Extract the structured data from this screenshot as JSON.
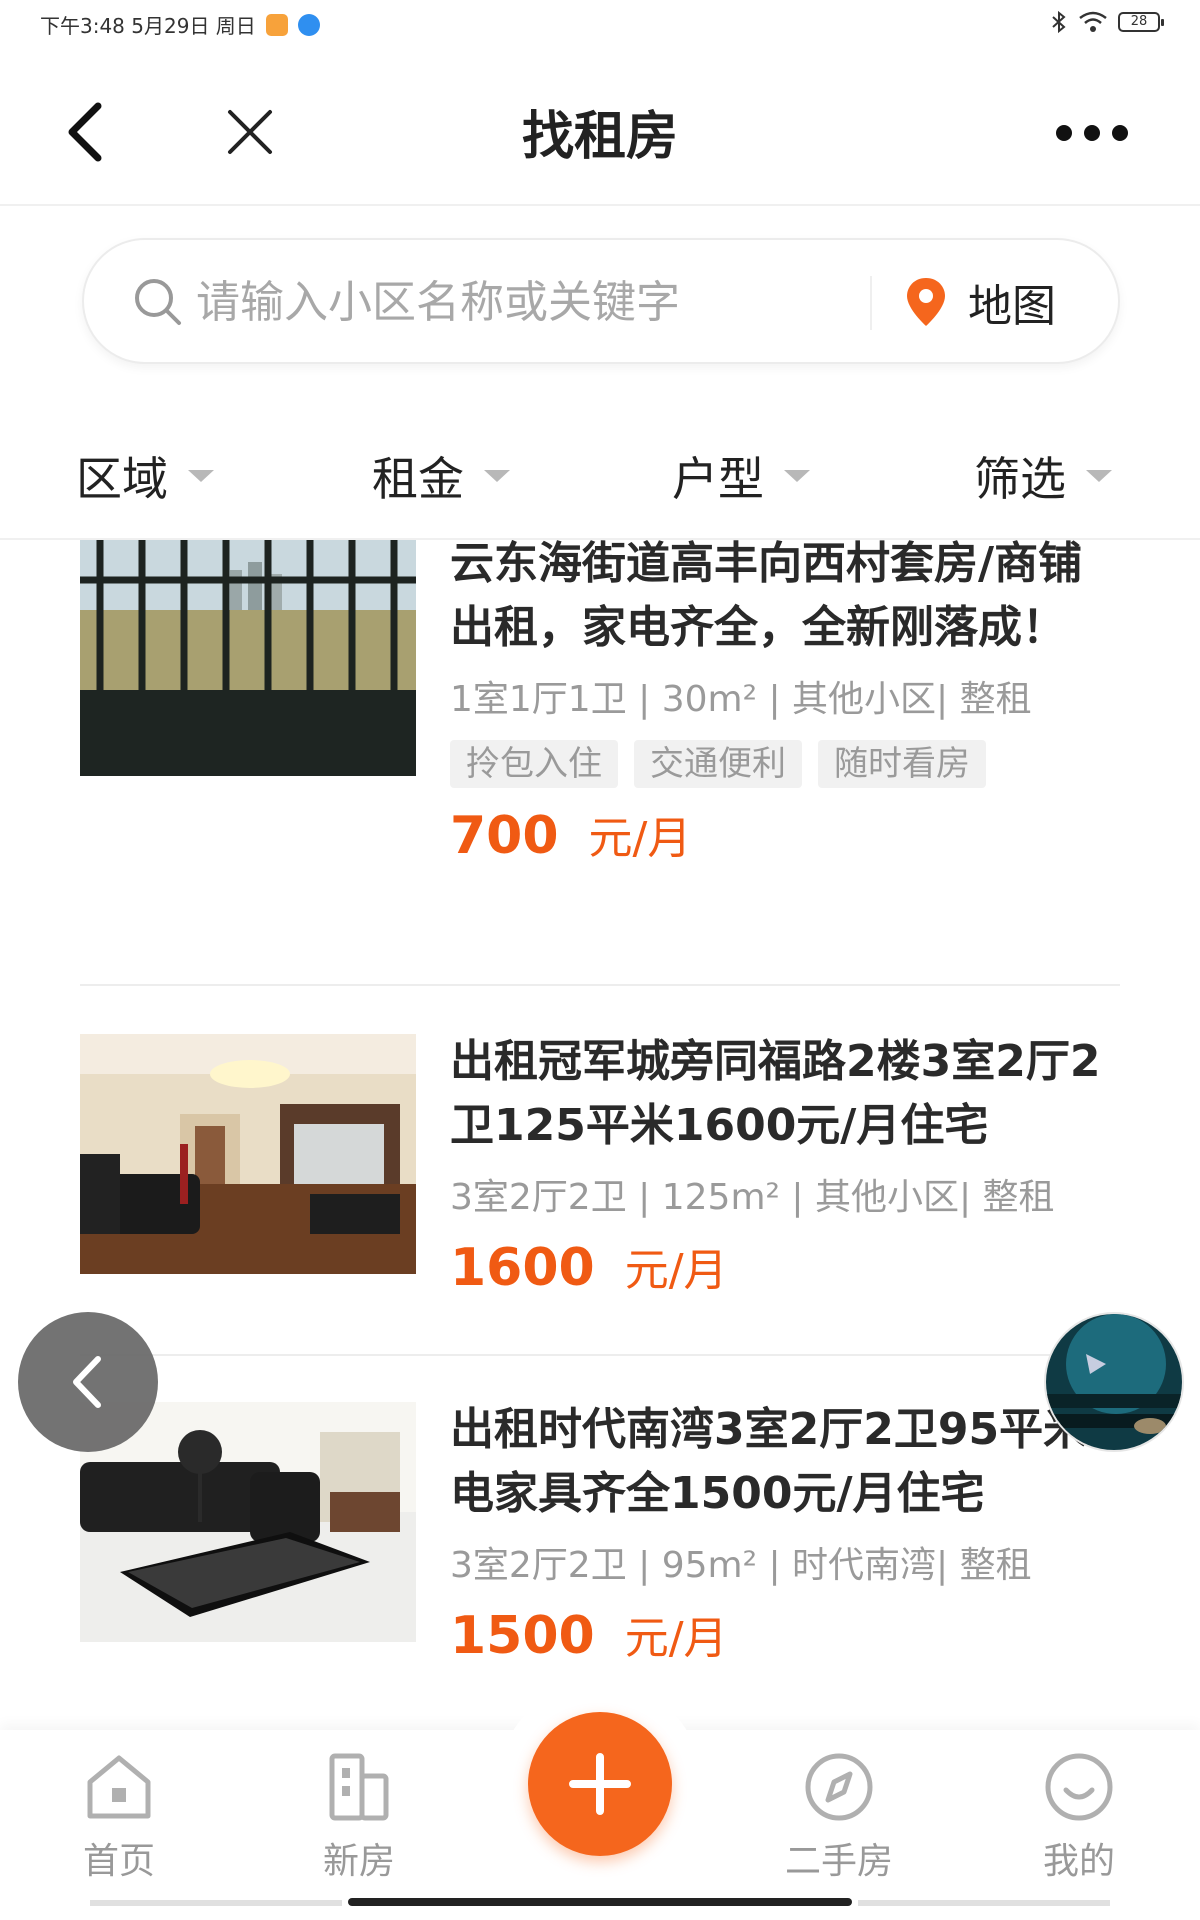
{
  "status_bar": {
    "time_date": "下午3:48  5月29日 周日",
    "battery": "28"
  },
  "nav": {
    "title": "找租房",
    "back_icon": "chevron-left-icon",
    "close_icon": "close-icon",
    "more_icon": "more-dots-icon"
  },
  "search": {
    "placeholder": "请输入小区名称或关键字",
    "map_label": "地图",
    "accent": "#f5661d"
  },
  "filters": [
    {
      "label": "区域"
    },
    {
      "label": "租金"
    },
    {
      "label": "户型"
    },
    {
      "label": "筛选"
    }
  ],
  "listings": [
    {
      "title": "云东海街道高丰向西村套房/商铺出租，家电齐全，全新刚落成！",
      "meta": "1室1厅1卫 | 30m² | 其他小区| 整租",
      "tags": [
        "拎包入住",
        "交通便利",
        "随时看房"
      ],
      "price": "700",
      "unit": "元/月"
    },
    {
      "title": "出租冠军城旁同福路2楼3室2厅2卫125平米1600元/月住宅",
      "meta": "3室2厅2卫 | 125m² | 其他小区| 整租",
      "tags": [],
      "price": "1600",
      "unit": "元/月"
    },
    {
      "title": "出租时代南湾3室2厅2卫95平米家电家具齐全1500元/月住宅",
      "meta": "3室2厅2卫 | 95m² | 时代南湾| 整租",
      "tags": [],
      "price": "1500",
      "unit": "元/月"
    }
  ],
  "tab_bar": {
    "items": [
      {
        "label": "首页",
        "icon": "home-icon"
      },
      {
        "label": "新房",
        "icon": "building-icon"
      },
      {
        "label": "二手房",
        "icon": "compass-icon"
      },
      {
        "label": "我的",
        "icon": "smile-icon"
      }
    ],
    "fab_icon": "plus-icon"
  },
  "colors": {
    "price": "#f05a13",
    "fab": "#f5661d"
  }
}
